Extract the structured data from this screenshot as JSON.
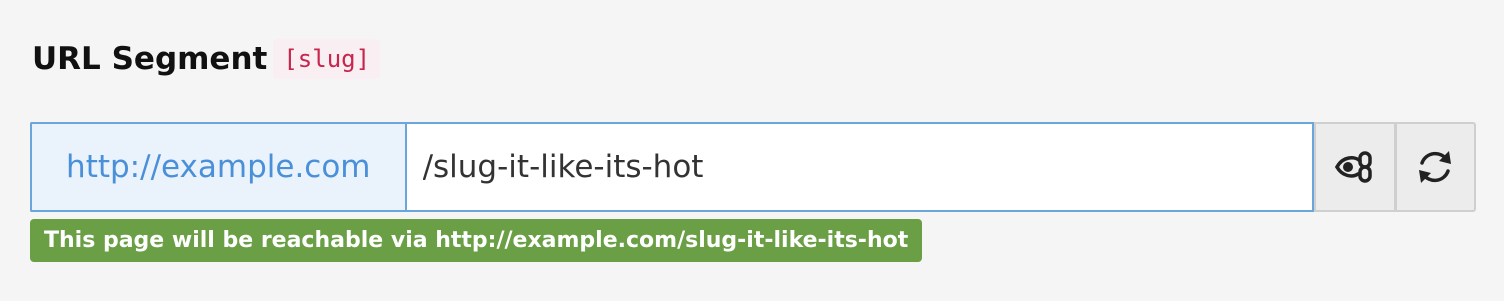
{
  "field": {
    "label": "URL Segment",
    "code": "[slug]"
  },
  "url": {
    "prefix": "http://example.com",
    "value": "/slug-it-like-its-hot"
  },
  "buttons": {
    "toggle_icon": "eye-link-icon",
    "recalculate_icon": "refresh-icon"
  },
  "status": {
    "message": "This page will be reachable via http://example.com/slug-it-like-its-hot",
    "color": "#6a9f45"
  },
  "colors": {
    "accent_border": "#6aa6dc",
    "prefix_text": "#4a90d9",
    "code_text": "#c7254e"
  }
}
